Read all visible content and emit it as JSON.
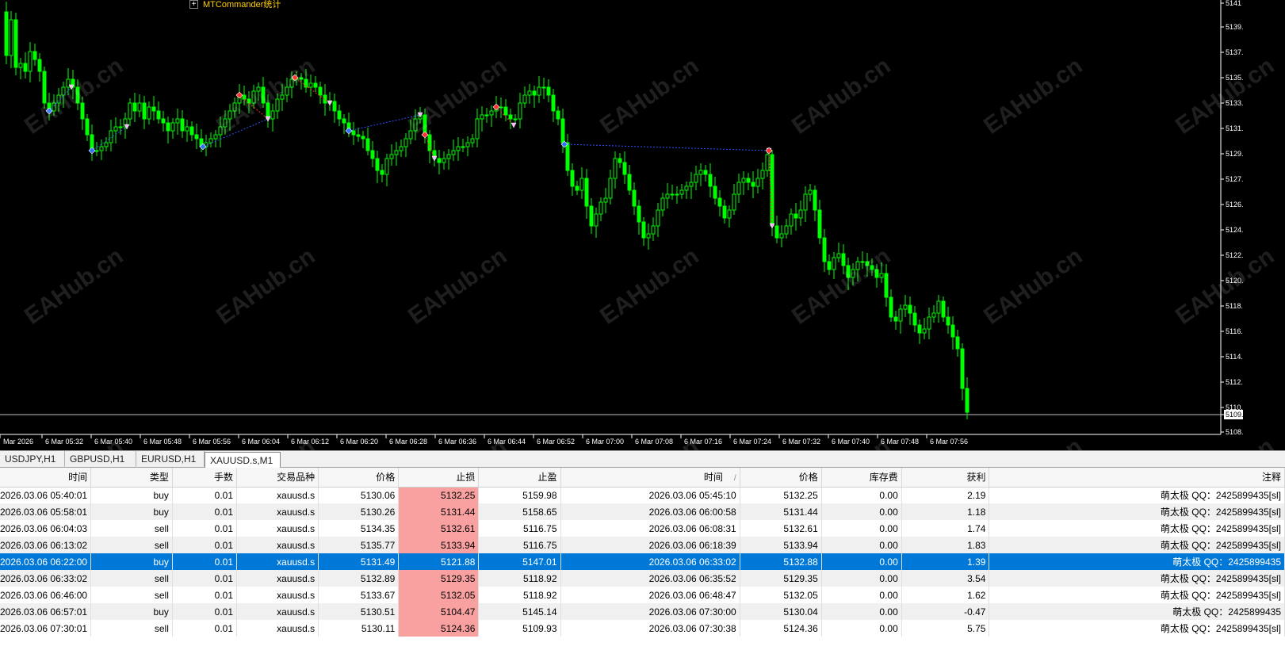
{
  "indicator": {
    "plus": "+",
    "label": "MTCommander统计"
  },
  "watermark": "EAHub.cn",
  "colors": {
    "background": "#000000",
    "candle": "#00ff00",
    "axis_text": "#ffffff",
    "selected_row": "#0078d7",
    "stoploss_cell": "#f9a0a0",
    "arrow_red": "#ff3030",
    "arrow_blue": "#3070ff",
    "dotted_line_blue": "#3050ff"
  },
  "chart": {
    "price_labels": [
      "5141",
      "5139.",
      "5137.",
      "5135.",
      "5133.",
      "5131.",
      "5129.",
      "5127.",
      "5126.",
      "5124.",
      "5122.",
      "5120.",
      "5118.",
      "5116.",
      "5114.",
      "5112.",
      "5110.",
      "5109.",
      "5108."
    ],
    "time_labels": [
      "Mar 2026",
      "6 Mar 05:32",
      "6 Mar 05:40",
      "6 Mar 05:48",
      "6 Mar 05:56",
      "6 Mar 06:04",
      "6 Mar 06:12",
      "6 Mar 06:20",
      "6 Mar 06:28",
      "6 Mar 06:36",
      "6 Mar 06:44",
      "6 Mar 06:52",
      "6 Mar 07:00",
      "6 Mar 07:08",
      "6 Mar 07:16",
      "6 Mar 07:24",
      "6 Mar 07:32",
      "6 Mar 07:40",
      "6 Mar 07:48",
      "6 Mar 07:56"
    ],
    "current_price": "5109."
  },
  "tabs": [
    "USDJPY,H1",
    "GBPUSD,H1",
    "EURUSD,H1",
    "XAUUSD.s,M1"
  ],
  "table": {
    "headers": [
      "时间",
      "类型",
      "手数",
      "交易品种",
      "价格",
      "止损",
      "止盈",
      "时间",
      "价格",
      "库存费",
      "获利",
      "注释"
    ],
    "sort_indicator": "/",
    "rows": [
      [
        "2026.03.06 05:40:01",
        "buy",
        "0.01",
        "xauusd.s",
        "5130.06",
        "5132.25",
        "5159.98",
        "2026.03.06 05:45:10",
        "5132.25",
        "0.00",
        "2.19",
        "萌太极  QQ：2425899435[sl]"
      ],
      [
        "2026.03.06 05:58:01",
        "buy",
        "0.01",
        "xauusd.s",
        "5130.26",
        "5131.44",
        "5158.65",
        "2026.03.06 06:00:58",
        "5131.44",
        "0.00",
        "1.18",
        "萌太极  QQ：2425899435[sl]"
      ],
      [
        "2026.03.06 06:04:03",
        "sell",
        "0.01",
        "xauusd.s",
        "5134.35",
        "5132.61",
        "5116.75",
        "2026.03.06 06:08:31",
        "5132.61",
        "0.00",
        "1.74",
        "萌太极  QQ：2425899435[sl]"
      ],
      [
        "2026.03.06 06:13:02",
        "sell",
        "0.01",
        "xauusd.s",
        "5135.77",
        "5133.94",
        "5116.75",
        "2026.03.06 06:18:39",
        "5133.94",
        "0.00",
        "1.83",
        "萌太极  QQ：2425899435[sl]"
      ],
      [
        "2026.03.06 06:22:00",
        "buy",
        "0.01",
        "xauusd.s",
        "5131.49",
        "5121.88",
        "5147.01",
        "2026.03.06 06:33:02",
        "5132.88",
        "0.00",
        "1.39",
        "萌太极  QQ：2425899435"
      ],
      [
        "2026.03.06 06:33:02",
        "sell",
        "0.01",
        "xauusd.s",
        "5132.89",
        "5129.35",
        "5118.92",
        "2026.03.06 06:35:52",
        "5129.35",
        "0.00",
        "3.54",
        "萌太极  QQ：2425899435[sl]"
      ],
      [
        "2026.03.06 06:46:00",
        "sell",
        "0.01",
        "xauusd.s",
        "5133.67",
        "5132.05",
        "5118.92",
        "2026.03.06 06:48:47",
        "5132.05",
        "0.00",
        "1.62",
        "萌太极  QQ：2425899435[sl]"
      ],
      [
        "2026.03.06 06:57:01",
        "buy",
        "0.01",
        "xauusd.s",
        "5130.51",
        "5104.47",
        "5145.14",
        "2026.03.06 07:30:00",
        "5130.04",
        "0.00",
        "-0.47",
        "萌太极  QQ：2425899435"
      ],
      [
        "2026.03.06 07:30:01",
        "sell",
        "0.01",
        "xauusd.s",
        "5130.11",
        "5124.36",
        "5109.93",
        "2026.03.06 07:30:38",
        "5124.36",
        "0.00",
        "5.75",
        "萌太极  QQ：2425899435[sl]"
      ]
    ],
    "selected_index": 4
  }
}
